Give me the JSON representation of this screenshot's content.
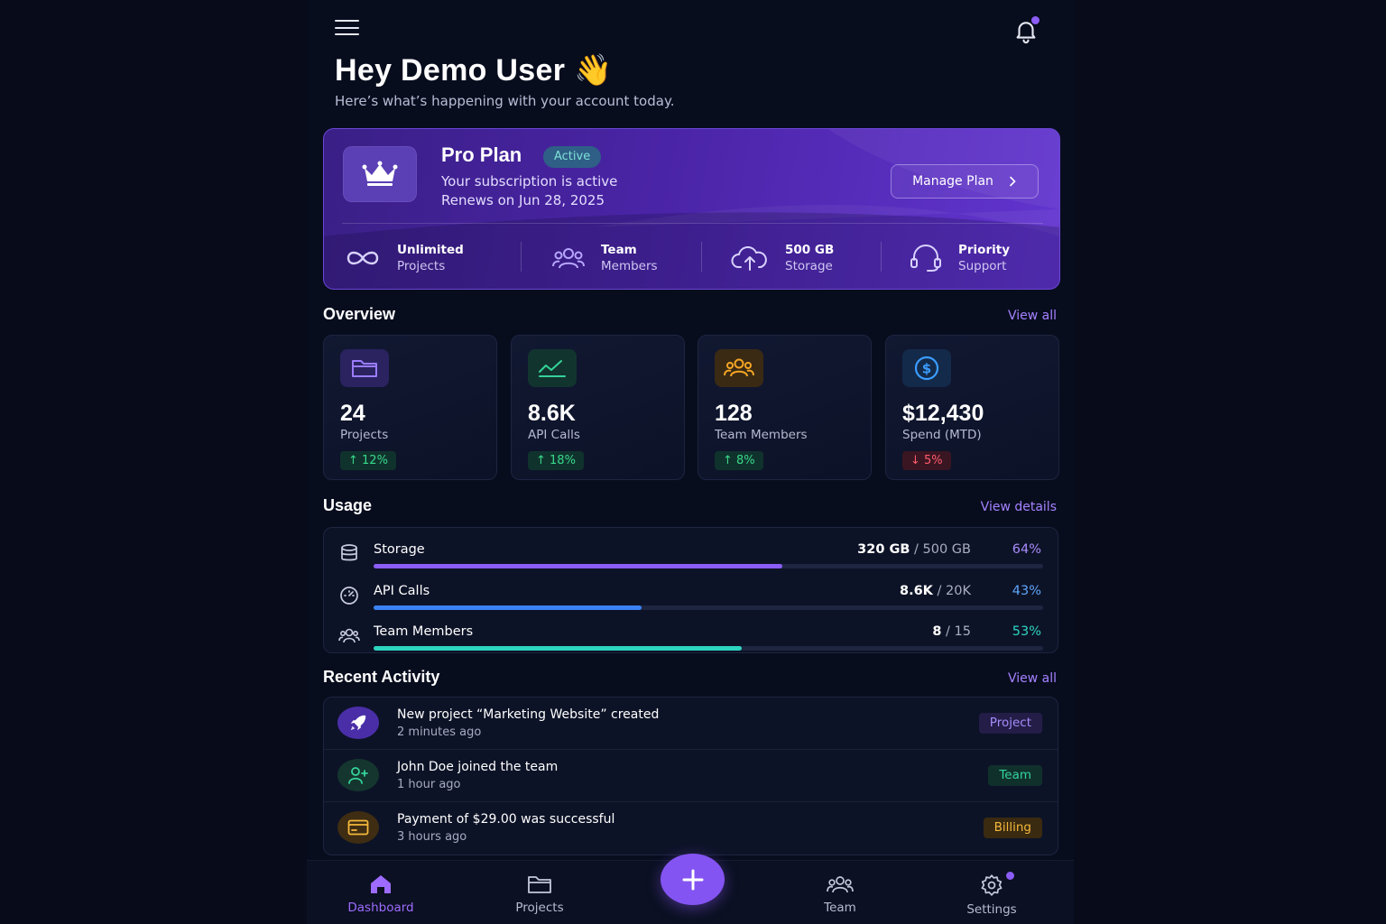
{
  "header": {
    "greeting": "Hey Demo User 👋",
    "subtitle": "Here’s what’s happening with your account today."
  },
  "plan": {
    "title": "Pro Plan",
    "status": "Active",
    "line1": "Your subscription is active",
    "line2": "Renews on Jun 28, 2025",
    "manage_label": "Manage Plan",
    "features": [
      {
        "icon": "infinity-icon",
        "title": "Unlimited",
        "sub": "Projects"
      },
      {
        "icon": "team-icon",
        "title": "Team",
        "sub": "Members"
      },
      {
        "icon": "cloud-upload-icon",
        "title": "500 GB",
        "sub": "Storage"
      },
      {
        "icon": "headset-icon",
        "title": "Priority",
        "sub": "Support"
      }
    ]
  },
  "overview": {
    "title": "Overview",
    "link": "View all",
    "cards": [
      {
        "icon": "folder-icon",
        "value": "24",
        "label": "Projects",
        "change": "12%",
        "direction": "up",
        "accent": "#8b6cf6",
        "icon_bg": "#2a2360"
      },
      {
        "icon": "chart-line-icon",
        "value": "8.6K",
        "label": "API Calls",
        "change": "18%",
        "direction": "up",
        "accent": "#34d399",
        "icon_bg": "#12342f"
      },
      {
        "icon": "users-icon",
        "value": "128",
        "label": "Team Members",
        "change": "8%",
        "direction": "up",
        "accent": "#f5a524",
        "icon_bg": "#3a2a14"
      },
      {
        "icon": "dollar-icon",
        "value": "$12,430",
        "label": "Spend (MTD)",
        "change": "5%",
        "direction": "down",
        "accent": "#3b9dff",
        "icon_bg": "#132a4a"
      }
    ]
  },
  "usage": {
    "title": "Usage",
    "link": "View details",
    "rows": [
      {
        "icon": "database-icon",
        "name": "Storage",
        "used": "320 GB",
        "max": "/ 500 GB",
        "pct": "64%",
        "fraction": 0.61,
        "color": "#8b5cf6"
      },
      {
        "icon": "gauge-icon",
        "name": "API Calls",
        "used": "8.6K",
        "max": "/ 20K",
        "pct": "43%",
        "fraction": 0.4,
        "color": "#3b82f6"
      },
      {
        "icon": "users-icon",
        "name": "Team Members",
        "used": "8",
        "max": "/ 15",
        "pct": "53%",
        "fraction": 0.55,
        "color": "#2dd4bf"
      }
    ]
  },
  "activity": {
    "title": "Recent Activity",
    "link": "View all",
    "rows": [
      {
        "icon": "rocket-icon",
        "title": "New project “Marketing Website” created",
        "time": "2 minutes ago",
        "tag": "Project",
        "tag_bg": "#231d47",
        "tag_fg": "#a78bfa",
        "icon_bg": "#4a2ea8"
      },
      {
        "icon": "user-plus-icon",
        "title": "John Doe joined the team",
        "time": "1 hour ago",
        "tag": "Team",
        "tag_bg": "#10302c",
        "tag_fg": "#34d399",
        "icon_bg": "#14362f"
      },
      {
        "icon": "credit-card-icon",
        "title": "Payment of $29.00 was successful",
        "time": "3 hours ago",
        "tag": "Billing",
        "tag_bg": "#3a2a10",
        "tag_fg": "#f5b83d",
        "icon_bg": "#3e2d12"
      }
    ]
  },
  "nav": {
    "items": [
      {
        "icon": "home-icon",
        "label": "Dashboard",
        "active": true
      },
      {
        "icon": "folder-icon",
        "label": "Projects"
      },
      {
        "icon": "team-icon",
        "label": "Team"
      },
      {
        "icon": "gear-icon",
        "label": "Settings"
      }
    ],
    "fab": "plus-icon"
  }
}
